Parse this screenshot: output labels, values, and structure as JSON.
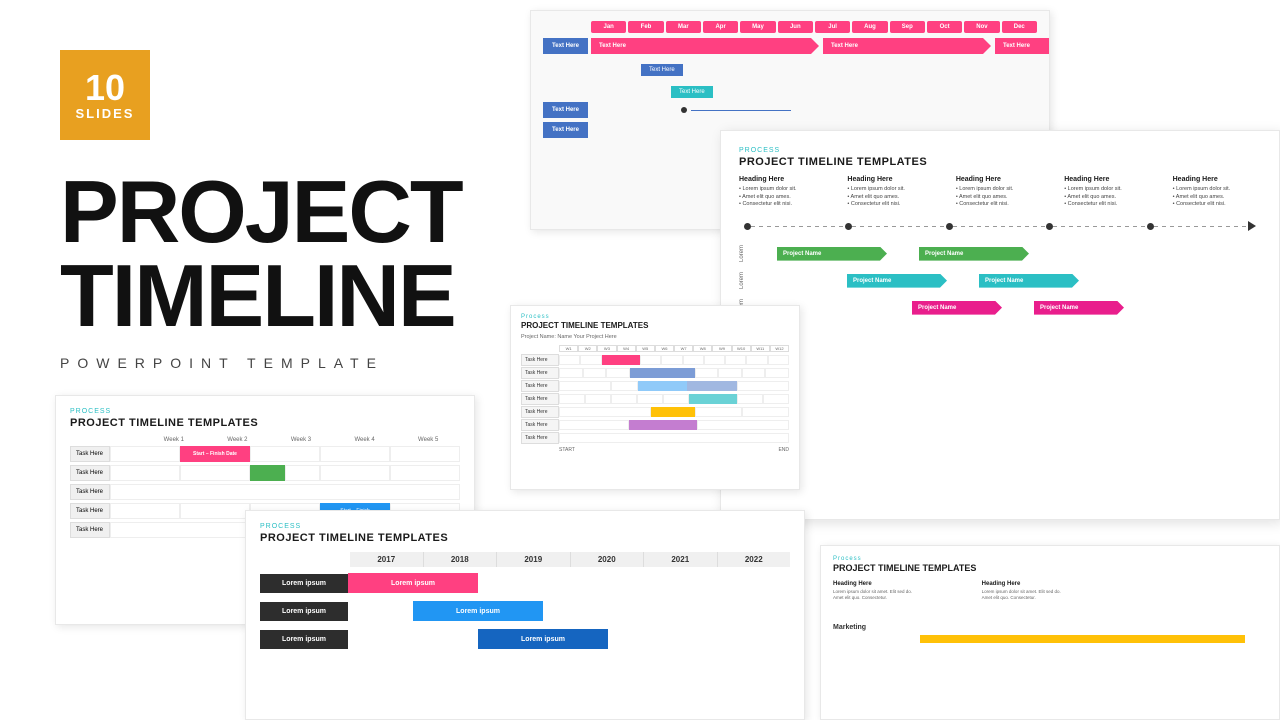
{
  "badge": {
    "number": "10",
    "label": "SLIDES"
  },
  "title": {
    "line1": "PROJECT",
    "line2": "TIMELINE",
    "subtitle": "POWERPOINT TEMPLATE"
  },
  "slide1": {
    "months": [
      "Jan",
      "Feb",
      "Mar",
      "Apr",
      "May",
      "Jun",
      "Jul",
      "Aug",
      "Sep",
      "Oct",
      "Nov",
      "Dec"
    ],
    "rows": [
      {
        "label": "Text Here",
        "bars": [
          {
            "text": "Text Here",
            "color": "pink",
            "span": 5
          },
          {
            "text": "Text Here",
            "color": "pink",
            "span": 4
          },
          {
            "text": "Text Here",
            "color": "pink",
            "span": 2
          }
        ]
      },
      {
        "label": "",
        "bars": [
          {
            "text": "Text Here",
            "color": "blue_small",
            "span": 2
          }
        ]
      },
      {
        "label": "",
        "bars": [
          {
            "text": "Text Here",
            "color": "blue_small2",
            "span": 2
          }
        ]
      },
      {
        "label": "Text Here",
        "bars": [
          {
            "text": "",
            "color": "blue_line",
            "span": 3
          }
        ]
      },
      {
        "label": "Text Here",
        "bars": []
      }
    ]
  },
  "slide2": {
    "process_label": "Process",
    "title": "PROJECT TIMELINE TEMPLATES",
    "headings": [
      "Heading Here",
      "Heading Here",
      "Heading Here",
      "Heading Here",
      "Heading Here"
    ],
    "bullet_text": "Lorem ipsum dolor sit. Amet elit quo ames. Consectetur elit nisi.",
    "project_rows": [
      {
        "lorem": "Lorem",
        "bars": [
          {
            "text": "Project Name",
            "color": "green"
          },
          {
            "text": "Project Name",
            "color": "green"
          }
        ]
      },
      {
        "lorem": "Lorem",
        "bars": [
          {
            "text": "Project Name",
            "color": "teal"
          },
          {
            "text": "Project Name",
            "color": "teal"
          }
        ]
      },
      {
        "lorem": "Lorem",
        "bars": [
          {
            "text": "Project Name",
            "color": "pink"
          },
          {
            "text": "Project Name",
            "color": "pink"
          }
        ]
      }
    ]
  },
  "slide3": {
    "title": "PROJECT TIMELINE TEMPLATES",
    "weeks": [
      "Week 1",
      "Week 2",
      "Week 3",
      "Week 4",
      "Week 5"
    ],
    "tasks": [
      {
        "label": "Task Here",
        "bar_type": "pink_wide",
        "bar_text": "Start – Finish Date"
      },
      {
        "label": "Task Here",
        "bar_type": "green_short",
        "bar_text": ""
      },
      {
        "label": "Task Here",
        "bar_type": "empty",
        "bar_text": ""
      },
      {
        "label": "Task Here",
        "bar_type": "blue_short",
        "bar_text": "Start – Finish"
      },
      {
        "label": "Task Here",
        "bar_type": "empty",
        "bar_text": ""
      }
    ]
  },
  "slide4": {
    "process_label": "Process",
    "title": "PROJECT TIMELINE TEMPLATES",
    "years": [
      "2017",
      "2018",
      "2019",
      "2020",
      "2021",
      "2022"
    ],
    "rows": [
      {
        "label": "Lorem ipsum",
        "bar_color": "pink",
        "bar_text": "Lorem ipsum"
      },
      {
        "label": "Lorem ipsum",
        "bar_color": "blue",
        "bar_text": "Lorem ipsum"
      },
      {
        "label": "Lorem ipsum",
        "bar_color": "blue2",
        "bar_text": "Lorem ipsum"
      }
    ]
  },
  "slide5": {
    "process_label": "Process",
    "title": "PROJECT TIMELINE TEMPLATES",
    "subtitle": "Project Name: Name Your Project Here",
    "tasks": [
      "Task Here",
      "Task Here",
      "Task Here",
      "Task Here",
      "Task Here",
      "Task Here",
      "Task Here"
    ],
    "start_label": "START",
    "end_label": "END"
  },
  "slide6": {
    "process_label": "Process",
    "title": "PROJECT TIMELINE TEMPLATES",
    "headings": [
      "Heading Here",
      "Heading Here"
    ],
    "heading_text": "Lorem ipsum dolor sit amet. Elit sed do eiusmod. Amet elit quo. Consectetur elit nisi.",
    "marketing_label": "Marketing"
  }
}
